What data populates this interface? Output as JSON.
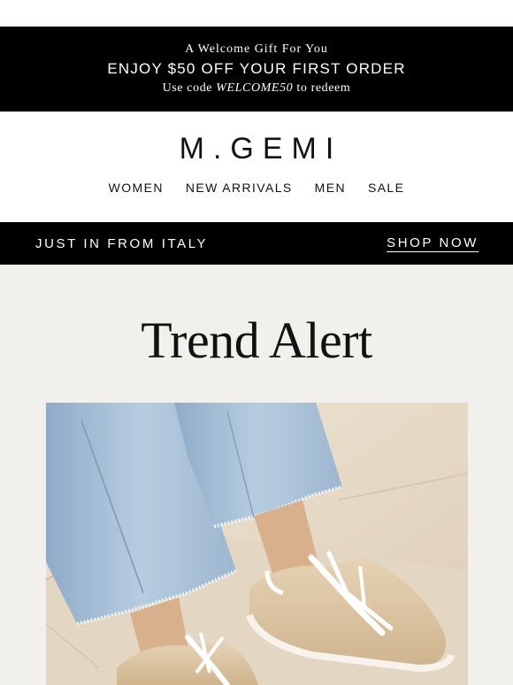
{
  "promo": {
    "eyebrow": "A Welcome Gift For You",
    "headline": "ENJOY $50 OFF YOUR FIRST ORDER",
    "code_prefix": "Use code ",
    "code": "WELCOME50",
    "code_suffix": " to redeem"
  },
  "brand": {
    "logo": "M.GEMI"
  },
  "nav": {
    "items": [
      {
        "label": "WOMEN"
      },
      {
        "label": "NEW ARRIVALS"
      },
      {
        "label": "MEN"
      },
      {
        "label": "SALE"
      }
    ]
  },
  "banner": {
    "left": "JUST IN FROM ITALY",
    "cta": "SHOP NOW"
  },
  "hero": {
    "title": "Trend Alert",
    "image": "jeans-and-suede-sneakers-photo"
  },
  "colors": {
    "black": "#000000",
    "canvas": "#f2f0ed",
    "denim": "#a9c1d8",
    "suede": "#dcc6a6"
  }
}
